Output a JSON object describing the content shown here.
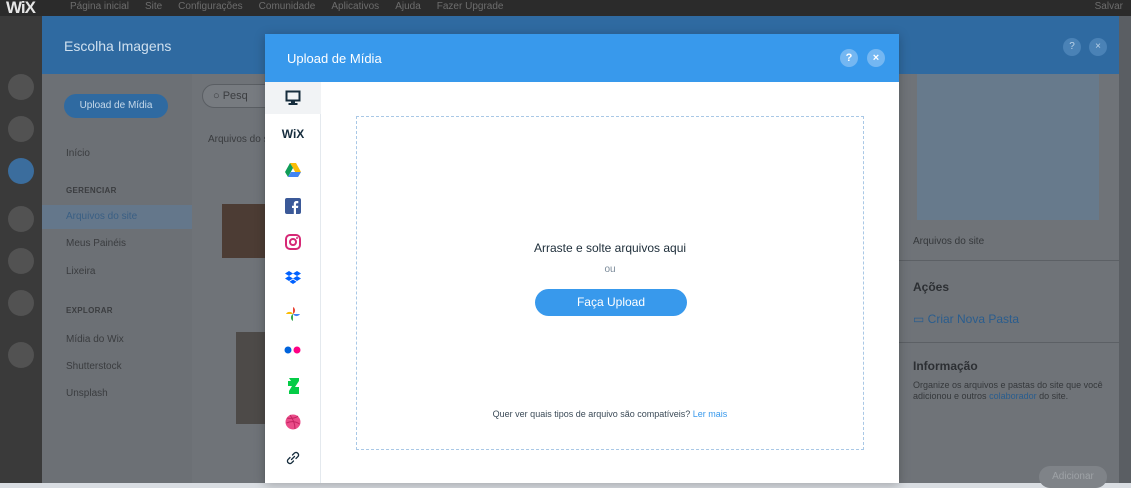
{
  "editor": {
    "logo": "WiX",
    "menu": [
      "Página inicial",
      "Site",
      "Configurações",
      "Comunidade",
      "Aplicativos",
      "Ajuda",
      "Fazer Upgrade"
    ],
    "user": "Salvar"
  },
  "background_dialog": {
    "title": "Escolha Imagens",
    "header_help": "?",
    "header_close": "×",
    "upload_button": "Upload de Mídia",
    "search_placeholder": "Pesq",
    "files_label": "Arquivos do site",
    "sidebar": {
      "inicio": "Início",
      "section_manage": "GERENCIAR",
      "item_site_files": "Arquivos do site",
      "item_my_panels": "Meus Painéis",
      "item_trash": "Lixeira",
      "section_explore": "EXPLORAR",
      "item_wix_media": "Mídia do Wix",
      "item_shutterstock": "Shutterstock",
      "item_unsplash": "Unsplash"
    },
    "right": {
      "caption": "Arquivos do site",
      "actions_title": "Ações",
      "new_folder": "Criar Nova Pasta",
      "info_title": "Informação",
      "info_text_1": "Organize os arquivos e pastas do site que você adicionou e outros",
      "info_link": "colaborador",
      "info_text_2": "do site.",
      "add_button": "Adicionar"
    }
  },
  "modal": {
    "title": "Upload de Mídia",
    "help": "?",
    "close": "×",
    "sources": [
      {
        "name": "my-computer-icon"
      },
      {
        "name": "wix-icon",
        "label": "WiX"
      },
      {
        "name": "google-drive-icon"
      },
      {
        "name": "facebook-icon"
      },
      {
        "name": "instagram-icon"
      },
      {
        "name": "dropbox-icon"
      },
      {
        "name": "google-photos-icon"
      },
      {
        "name": "flickr-icon"
      },
      {
        "name": "deviantart-icon"
      },
      {
        "name": "dribbble-icon"
      },
      {
        "name": "link-icon"
      }
    ],
    "drop_text": "Arraste e solte arquivos aqui",
    "or_text": "ou",
    "upload_button": "Faça Upload",
    "compat_text": "Quer ver quais tipos de arquivo são compatíveis?",
    "compat_link": "Ler mais"
  },
  "colors": {
    "modal_header": "#3899ec",
    "primary_button": "#3899ec",
    "drop_border": "#a9c8e6"
  }
}
